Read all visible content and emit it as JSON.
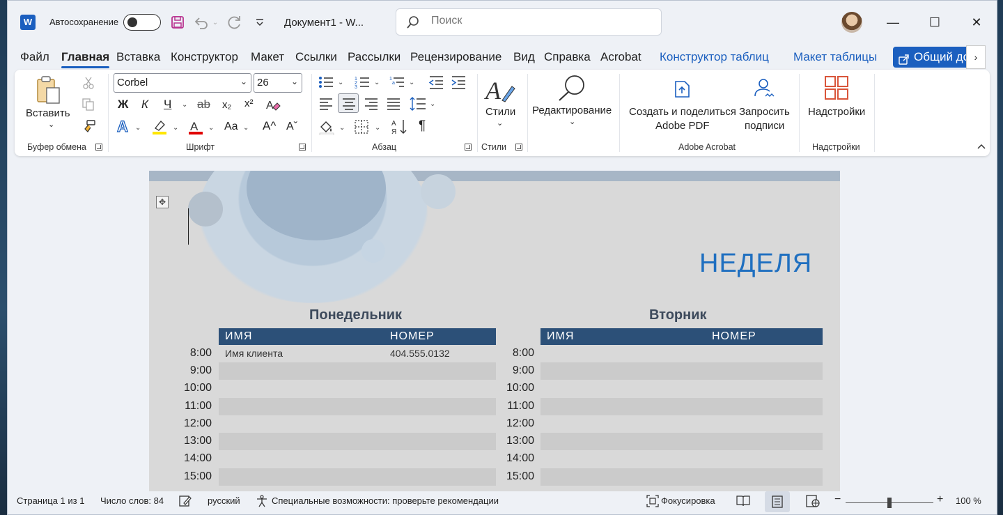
{
  "titlebar": {
    "autosave_label": "Автосохранение",
    "doc_title": "Документ1  -  W...",
    "search_placeholder": "Поиск",
    "minimize": "—",
    "maximize": "☐",
    "close": "✕"
  },
  "tabs": [
    {
      "label": "Файл"
    },
    {
      "label": "Главная",
      "active": true
    },
    {
      "label": "Вставка"
    },
    {
      "label": "Конструктор"
    },
    {
      "label": "Макет"
    },
    {
      "label": "Ссылки"
    },
    {
      "label": "Рассылки"
    },
    {
      "label": "Рецензирование"
    },
    {
      "label": "Вид"
    },
    {
      "label": "Справка"
    },
    {
      "label": "Acrobat"
    },
    {
      "label": "Конструктор таблиц",
      "context": true
    },
    {
      "label": "Макет таблицы",
      "context": true
    }
  ],
  "share_label": "Общий доступ",
  "ribbon": {
    "paste_label": "Вставить",
    "clipboard_group": "Буфер обмена",
    "font_name": "Corbel",
    "font_size": "26",
    "font_group": "Шрифт",
    "bold": "Ж",
    "italic": "К",
    "underline": "Ч",
    "strike": "ab",
    "sub": "x₂",
    "sup": "x²",
    "case": "Aa",
    "grow": "A^",
    "shrink": "Aˇ",
    "paragraph_group": "Абзац",
    "pilcrow": "¶",
    "styles_label": "Стили",
    "styles_group": "Стили",
    "editing_label": "Редактирование",
    "acrobat_create_line1": "Создать и поделиться",
    "acrobat_create_line2": "Adobe PDF",
    "acrobat_sign_line1": "Запросить",
    "acrobat_sign_line2": "подписи",
    "acrobat_group": "Adobe Acrobat",
    "addins_label": "Надстройки",
    "addins_group": "Надстройки"
  },
  "document": {
    "week_title": "НЕДЕЛЯ",
    "days": [
      {
        "name": "Понедельник",
        "col_name": "ИМЯ",
        "col_number": "НОМЕР"
      },
      {
        "name": "Вторник",
        "col_name": "ИМЯ",
        "col_number": "НОМЕР"
      }
    ],
    "times": [
      "8:00",
      "9:00",
      "10:00",
      "11:00",
      "12:00",
      "13:00",
      "14:00",
      "15:00"
    ],
    "monday_first_row": {
      "name": "Имя клиента",
      "number": "404.555.0132"
    }
  },
  "status": {
    "page": "Страница 1 из 1",
    "words": "Число слов: 84",
    "language": "русский",
    "accessibility": "Специальные возможности: проверьте рекомендации",
    "focus": "Фокусировка",
    "zoom_minus": "−",
    "zoom_plus": "+",
    "zoom": "100 %"
  },
  "colors": {
    "accent": "#1b5fbf",
    "table_header": "#2c5078",
    "week_title": "#1f6fc0"
  }
}
